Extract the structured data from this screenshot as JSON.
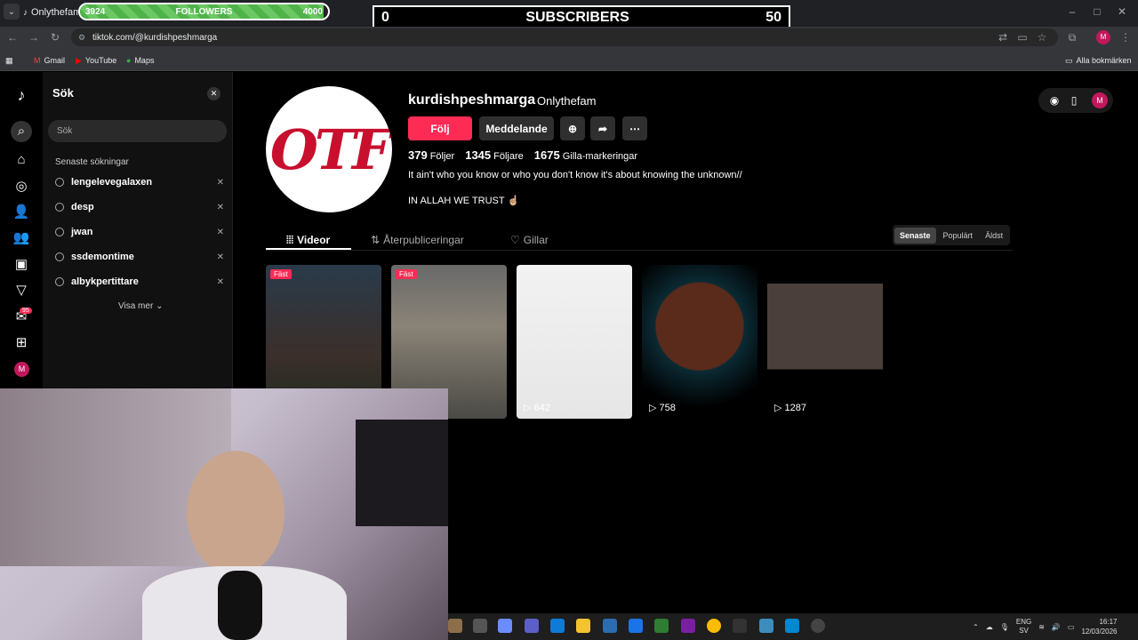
{
  "browser": {
    "tab_title": "Onlythefam",
    "url": "tiktok.com/@kurdishpeshmarga",
    "bookmarks": [
      "Gmail",
      "YouTube",
      "Maps"
    ],
    "all_bookmarks": "Alla bokmärken"
  },
  "overlay": {
    "followers_current": "3924",
    "followers_label": "FOLLOWERS",
    "followers_goal": "4000",
    "followers_progress": 0.981,
    "subs_current": "0",
    "subs_label": "SUBSCRIBERS",
    "subs_goal": "50"
  },
  "search_panel": {
    "title": "Sök",
    "placeholder": "Sök",
    "recent_label": "Senaste sökningar",
    "recent": [
      "lengelevegalaxen",
      "desp",
      "jwan",
      "ssdemontime",
      "albykpertittare"
    ],
    "show_more": "Visa mer"
  },
  "nav": {
    "inbox_badge": "95",
    "avatar_letter": "M"
  },
  "profile": {
    "avatar_text": "OTF",
    "username": "kurdishpeshmarga",
    "nickname": "Onlythefam",
    "follow_label": "Följ",
    "message_label": "Meddelande",
    "following_count": "379",
    "following_label": "Följer",
    "followers_count": "1345",
    "followers_label": "Följare",
    "likes_count": "1675",
    "likes_label": "Gilla-markeringar",
    "bio_line1": "It ain't who you know or who you don't know it's about knowing the unknown//",
    "bio_line2": "IN ALLAH WE TRUST ☝🏼"
  },
  "tabs": [
    {
      "label": "Videor"
    },
    {
      "label": "Återpubliceringar"
    },
    {
      "label": "Gillar"
    }
  ],
  "sort": [
    "Senaste",
    "Populärt",
    "Äldst"
  ],
  "videos": [
    {
      "pinned": "Fäst",
      "views": ""
    },
    {
      "pinned": "Fäst",
      "views": ""
    },
    {
      "pinned": "",
      "views": "642"
    },
    {
      "pinned": "",
      "views": "758"
    },
    {
      "pinned": "",
      "views": "1287"
    }
  ],
  "taskbar": {
    "lang": "ENG",
    "lang2": "SV",
    "time": "16:17",
    "date": "12/03/2026"
  }
}
